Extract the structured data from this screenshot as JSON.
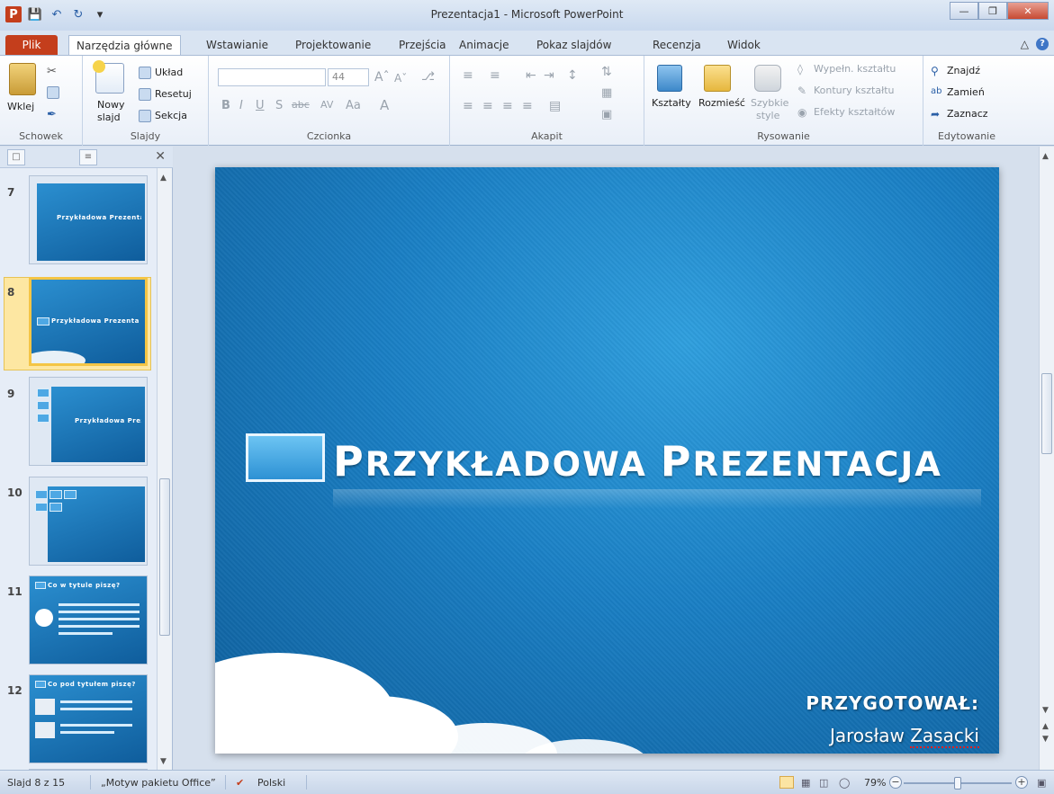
{
  "window": {
    "title": "Prezentacja1 - Microsoft PowerPoint"
  },
  "tabs": [
    {
      "label": "Plik"
    },
    {
      "label": "Narzędzia główne"
    },
    {
      "label": "Wstawianie"
    },
    {
      "label": "Projektowanie"
    },
    {
      "label": "Przejścia"
    },
    {
      "label": "Animacje"
    },
    {
      "label": "Pokaz slajdów"
    },
    {
      "label": "Recenzja"
    },
    {
      "label": "Widok"
    }
  ],
  "ribbon": {
    "clipboard": {
      "paste": "Wklej",
      "group": "Schowek"
    },
    "slides": {
      "new_slide_1": "Nowy",
      "new_slide_2": "slajd",
      "layout": "Układ",
      "reset": "Resetuj",
      "section": "Sekcja",
      "group": "Slajdy"
    },
    "font": {
      "size": "44",
      "group": "Czcionka"
    },
    "paragraph": {
      "group": "Akapit"
    },
    "drawing": {
      "shapes": "Kształty",
      "arrange": "Rozmieść",
      "quick_styles_1": "Szybkie",
      "quick_styles_2": "style",
      "shape_fill": "Wypełn. kształtu",
      "shape_outline": "Kontury kształtu",
      "shape_effects": "Efekty kształtów",
      "group": "Rysowanie"
    },
    "editing": {
      "find": "Znajdź",
      "replace": "Zamień",
      "select": "Zaznacz",
      "group": "Edytowanie"
    }
  },
  "thumbnails": [
    {
      "number": "7",
      "title": "Przykładowa Prezentacja"
    },
    {
      "number": "8",
      "title": "Przykładowa Prezentacja"
    },
    {
      "number": "9",
      "title": "Przykładowa Prezentacja"
    },
    {
      "number": "10",
      "title": ""
    },
    {
      "number": "11",
      "title": "Co w tytule piszę?"
    },
    {
      "number": "12",
      "title": "Co pod tytułem piszę?"
    }
  ],
  "slide": {
    "title_cap1": "P",
    "title_part1": "RZYKŁADOWA ",
    "title_cap2": "P",
    "title_part2": "REZENTACJA",
    "author_label": "PRZYGOTOWAŁ:",
    "author_first": "Jarosław",
    "author_last": "Zasacki"
  },
  "statusbar": {
    "slide_info": "Slajd 8 z 15",
    "theme": "„Motyw pakietu Office”",
    "language": "Polski",
    "zoom": "79%"
  },
  "colors": {
    "accent": "#c43e1c",
    "slide_blue": "#1a7fc4",
    "selection": "#f4c545"
  }
}
